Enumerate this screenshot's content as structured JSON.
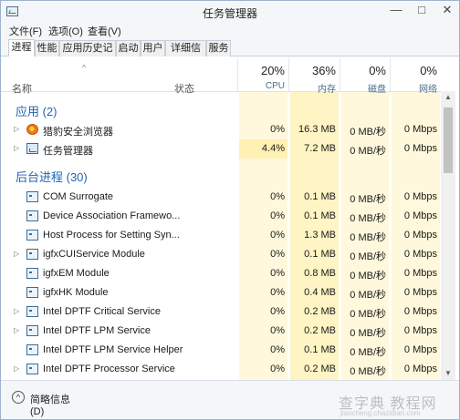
{
  "window": {
    "title": "任务管理器",
    "min_glyph": "—",
    "max_glyph": "□",
    "close_glyph": "✕"
  },
  "menu": [
    "文件(F)",
    "选项(O)",
    "查看(V)"
  ],
  "tabs": [
    "进程",
    "性能",
    "应用历史记录",
    "启动",
    "用户",
    "详细信息",
    "服务"
  ],
  "active_tab": "进程",
  "header": {
    "sort_glyph": "^",
    "name": "名称",
    "status": "状态",
    "cpu_pct": "20%",
    "cpu": "CPU",
    "mem_pct": "36%",
    "mem": "内存",
    "disk_pct": "0%",
    "disk": "磁盘",
    "net_pct": "0%",
    "net": "网络"
  },
  "groups": {
    "apps": "应用 (2)",
    "background": "后台进程 (30)"
  },
  "apps": [
    {
      "name": "猎豹安全浏览器",
      "icon": "browser-icon",
      "cpu": "0%",
      "mem": "16.3 MB",
      "disk": "0 MB/秒",
      "net": "0 Mbps"
    },
    {
      "name": "任务管理器",
      "icon": "task-manager-icon",
      "cpu": "4.4%",
      "mem": "7.2 MB",
      "disk": "0 MB/秒",
      "net": "0 Mbps"
    }
  ],
  "background": [
    {
      "name": "COM Surrogate",
      "expand": false,
      "cpu": "0%",
      "mem": "0.1 MB",
      "disk": "0 MB/秒",
      "net": "0 Mbps"
    },
    {
      "name": "Device Association Framewo...",
      "expand": false,
      "cpu": "0%",
      "mem": "0.1 MB",
      "disk": "0 MB/秒",
      "net": "0 Mbps"
    },
    {
      "name": "Host Process for Setting Syn...",
      "expand": false,
      "cpu": "0%",
      "mem": "1.3 MB",
      "disk": "0 MB/秒",
      "net": "0 Mbps"
    },
    {
      "name": "igfxCUIService Module",
      "expand": true,
      "cpu": "0%",
      "mem": "0.1 MB",
      "disk": "0 MB/秒",
      "net": "0 Mbps"
    },
    {
      "name": "igfxEM Module",
      "expand": false,
      "cpu": "0%",
      "mem": "0.8 MB",
      "disk": "0 MB/秒",
      "net": "0 Mbps"
    },
    {
      "name": "igfxHK Module",
      "expand": false,
      "cpu": "0%",
      "mem": "0.4 MB",
      "disk": "0 MB/秒",
      "net": "0 Mbps"
    },
    {
      "name": "Intel DPTF Critical Service",
      "expand": true,
      "cpu": "0%",
      "mem": "0.2 MB",
      "disk": "0 MB/秒",
      "net": "0 Mbps"
    },
    {
      "name": "Intel DPTF LPM Service",
      "expand": true,
      "cpu": "0%",
      "mem": "0.2 MB",
      "disk": "0 MB/秒",
      "net": "0 Mbps"
    },
    {
      "name": "Intel DPTF LPM Service Helper",
      "expand": false,
      "cpu": "0%",
      "mem": "0.1 MB",
      "disk": "0 MB/秒",
      "net": "0 Mbps"
    },
    {
      "name": "Intel DPTF Processor Service",
      "expand": true,
      "cpu": "0%",
      "mem": "0.2 MB",
      "disk": "0 MB/秒",
      "net": "0 Mbps"
    }
  ],
  "footer": {
    "fewer_details_glyph": "^",
    "fewer_details": "简略信息(D)"
  },
  "watermark": {
    "main": "查字典 教程网",
    "sub": "jiaocheng.chazidian.com"
  },
  "colors": {
    "group_heading": "#1e63b4",
    "heat_light": "#fff8dc",
    "heat_mem": "#fff4c4"
  }
}
